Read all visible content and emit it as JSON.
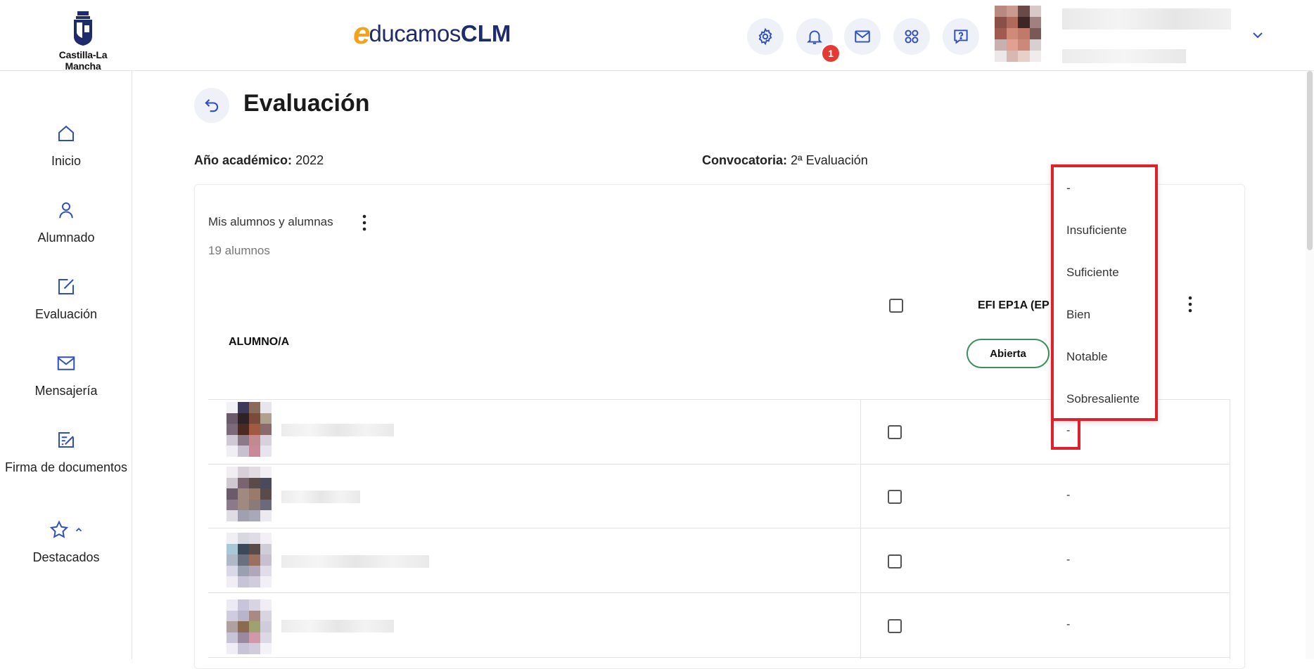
{
  "header": {
    "region_logo_text": "Castilla-La Mancha",
    "brand_e": "e",
    "brand_rest": "ducamos",
    "brand_clm": "CLM",
    "notification_count": "1"
  },
  "sidebar": {
    "items": [
      {
        "label": "Inicio",
        "icon": "home-icon"
      },
      {
        "label": "Alumnado",
        "icon": "user-icon"
      },
      {
        "label": "Evaluación",
        "icon": "edit-icon"
      },
      {
        "label": "Mensajería",
        "icon": "mail-icon"
      },
      {
        "label": "Firma de documentos",
        "icon": "sign-document-icon"
      },
      {
        "label": "Destacados",
        "icon": "star-icon"
      }
    ]
  },
  "page": {
    "title": "Evaluación",
    "academic_year_label": "Año académico:",
    "academic_year_value": "2022",
    "call_label": "Convocatoria:",
    "call_value": "2ª Evaluación"
  },
  "card": {
    "title": "Mis alumnos y alumnas",
    "subtitle": "19 alumnos",
    "student_column": "ALUMNO/A",
    "subject_column": "EFI EP1A (EP",
    "status_pill": "Abierta"
  },
  "rows": [
    {
      "grade": "-"
    },
    {
      "grade": "-"
    },
    {
      "grade": "-"
    },
    {
      "grade": "-"
    }
  ],
  "dropdown": {
    "options": [
      "-",
      "Insuficiente",
      "Suficiente",
      "Bien",
      "Notable",
      "Sobresaliente"
    ]
  },
  "colors": {
    "accent": "#2f4fbf",
    "highlight": "#e0202a",
    "pill_border": "#3c8f5b"
  }
}
